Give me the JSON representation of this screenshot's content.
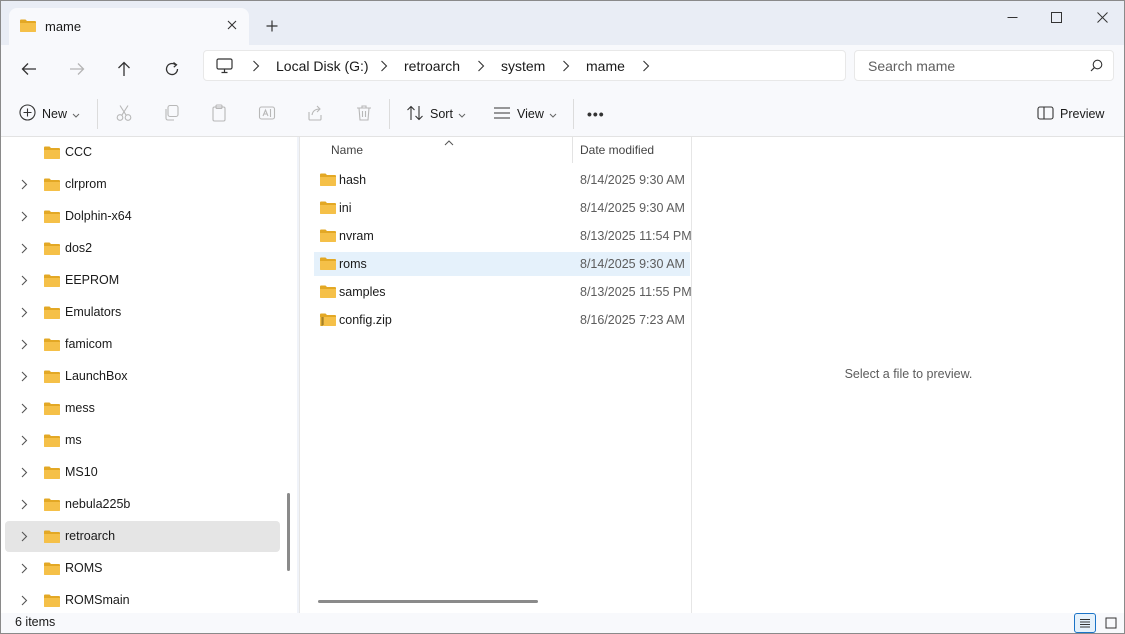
{
  "window": {
    "tab_title": "mame"
  },
  "addressbar": {
    "crumbs": [
      "Local Disk (G:)",
      "retroarch",
      "system",
      "mame"
    ]
  },
  "search": {
    "placeholder": "Search mame"
  },
  "commandbar": {
    "new_label": "New",
    "sort_label": "Sort",
    "view_label": "View",
    "more_label": "•••",
    "preview_label": "Preview"
  },
  "navpane": {
    "items": [
      {
        "label": "CCC",
        "expandable": false
      },
      {
        "label": "clrprom",
        "expandable": true
      },
      {
        "label": "Dolphin-x64",
        "expandable": true
      },
      {
        "label": "dos2",
        "expandable": true
      },
      {
        "label": "EEPROM",
        "expandable": true
      },
      {
        "label": "Emulators",
        "expandable": true
      },
      {
        "label": "famicom",
        "expandable": true
      },
      {
        "label": "LaunchBox",
        "expandable": true
      },
      {
        "label": "mess",
        "expandable": true
      },
      {
        "label": "ms",
        "expandable": true
      },
      {
        "label": "MS10",
        "expandable": true
      },
      {
        "label": "nebula225b",
        "expandable": true
      },
      {
        "label": "retroarch",
        "expandable": true,
        "selected": true
      },
      {
        "label": "ROMS",
        "expandable": true
      },
      {
        "label": "ROMSmain",
        "expandable": true
      }
    ]
  },
  "filelist": {
    "columns": {
      "name": "Name",
      "date": "Date modified"
    },
    "rows": [
      {
        "name": "hash",
        "date": "8/14/2025 9:30 AM",
        "type": "folder"
      },
      {
        "name": "ini",
        "date": "8/14/2025 9:30 AM",
        "type": "folder"
      },
      {
        "name": "nvram",
        "date": "8/13/2025 11:54 PM",
        "type": "folder"
      },
      {
        "name": "roms",
        "date": "8/14/2025 9:30 AM",
        "type": "folder",
        "selected": true
      },
      {
        "name": "samples",
        "date": "8/13/2025 11:55 PM",
        "type": "folder"
      },
      {
        "name": "config.zip",
        "date": "8/16/2025 7:23 AM",
        "type": "zip"
      }
    ]
  },
  "preview": {
    "message": "Select a file to preview."
  },
  "status": {
    "item_count": "6 items"
  },
  "colors": {
    "folder": "#f5c048",
    "folder_dark": "#e3a825",
    "selection": "#e5f1fb",
    "accent": "#1a73c7"
  }
}
